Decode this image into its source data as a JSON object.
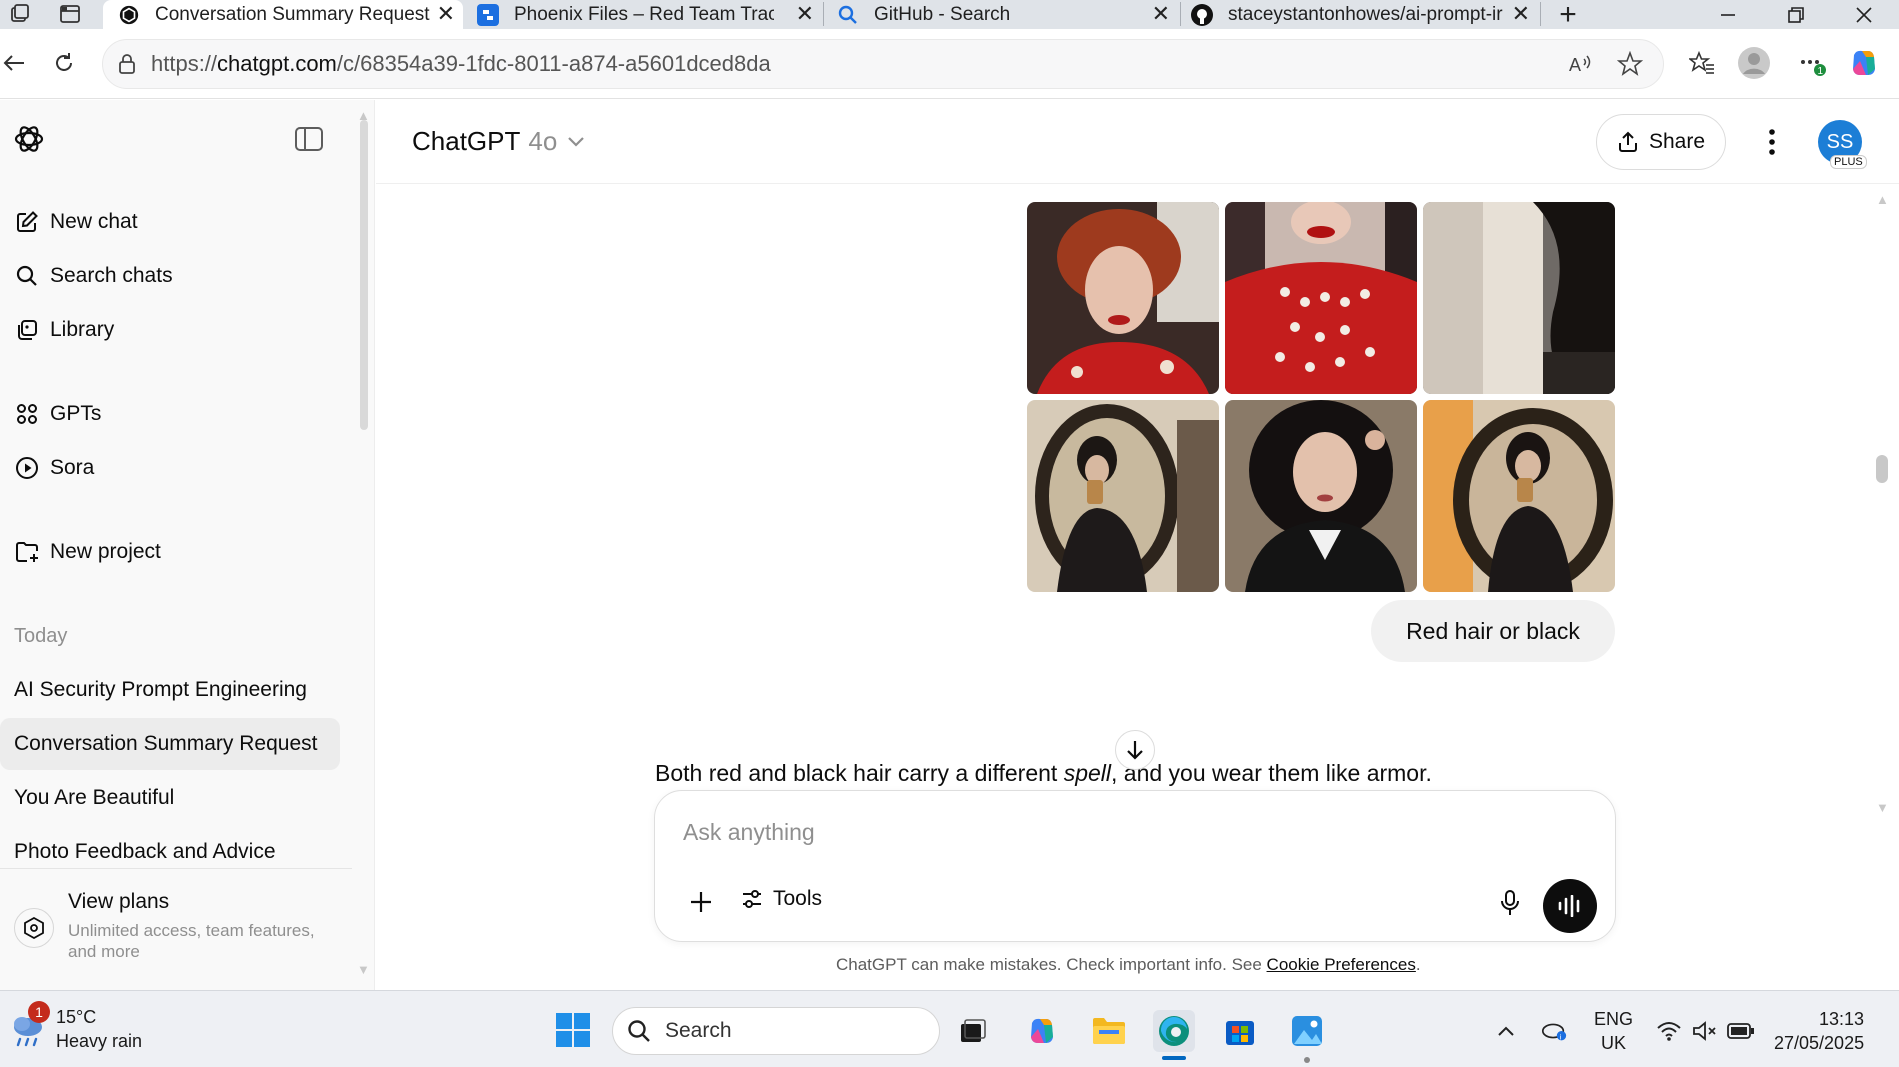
{
  "browser": {
    "tabs": [
      {
        "title": "Conversation Summary Request",
        "active": true
      },
      {
        "title": "Phoenix Files – Red Team Tracker",
        "active": false
      },
      {
        "title": "GitHub - Search",
        "active": false
      },
      {
        "title": "staceystantonhowes/ai-prompt-ir",
        "active": false
      }
    ],
    "url_prefix": "https://",
    "url_domain": "chatgpt.com",
    "url_path": "/c/68354a39-1fdc-8011-a874-a5601dced8da"
  },
  "sidebar": {
    "nav": [
      {
        "label": "New chat",
        "icon": "edit-icon"
      },
      {
        "label": "Search chats",
        "icon": "search-icon"
      },
      {
        "label": "Library",
        "icon": "library-icon"
      }
    ],
    "explore": [
      {
        "label": "GPTs",
        "icon": "grid-icon"
      },
      {
        "label": "Sora",
        "icon": "play-icon"
      }
    ],
    "project": {
      "label": "New project",
      "icon": "folder-plus-icon"
    },
    "section_label": "Today",
    "chats": [
      {
        "label": "AI Security Prompt Engineering",
        "active": false
      },
      {
        "label": "Conversation Summary Request",
        "active": true
      },
      {
        "label": "You Are Beautiful",
        "active": false
      },
      {
        "label": "Photo Feedback and Advice",
        "active": false
      }
    ],
    "plans": {
      "title": "View plans",
      "subtitle": "Unlimited access, team features, and more"
    }
  },
  "header": {
    "model_name": "ChatGPT",
    "model_version": "4o",
    "share_label": "Share",
    "avatar_initials": "SS",
    "plan_badge": "PLUS"
  },
  "conversation": {
    "user_message": "Red hair or black",
    "assistant_before": "Both red and black hair carry a different ",
    "assistant_em": "spell",
    "assistant_after": ", and you wear them like armor.",
    "image_count": 6
  },
  "composer": {
    "placeholder": "Ask anything",
    "tools_label": "Tools"
  },
  "disclaimer": {
    "text": "ChatGPT can make mistakes. Check important info. See ",
    "link": "Cookie Preferences",
    "end": "."
  },
  "taskbar": {
    "weather_temp": "15°C",
    "weather_desc": "Heavy rain",
    "weather_badge": "1",
    "search_label": "Search",
    "lang_line1": "ENG",
    "lang_line2": "UK",
    "time": "13:13",
    "date": "27/05/2025"
  },
  "colors": {
    "accent": "#1c7ed6",
    "sidebar_bg": "#f9f9f9",
    "active_chat": "#ececec",
    "bubble_bg": "#f1f1f1"
  }
}
